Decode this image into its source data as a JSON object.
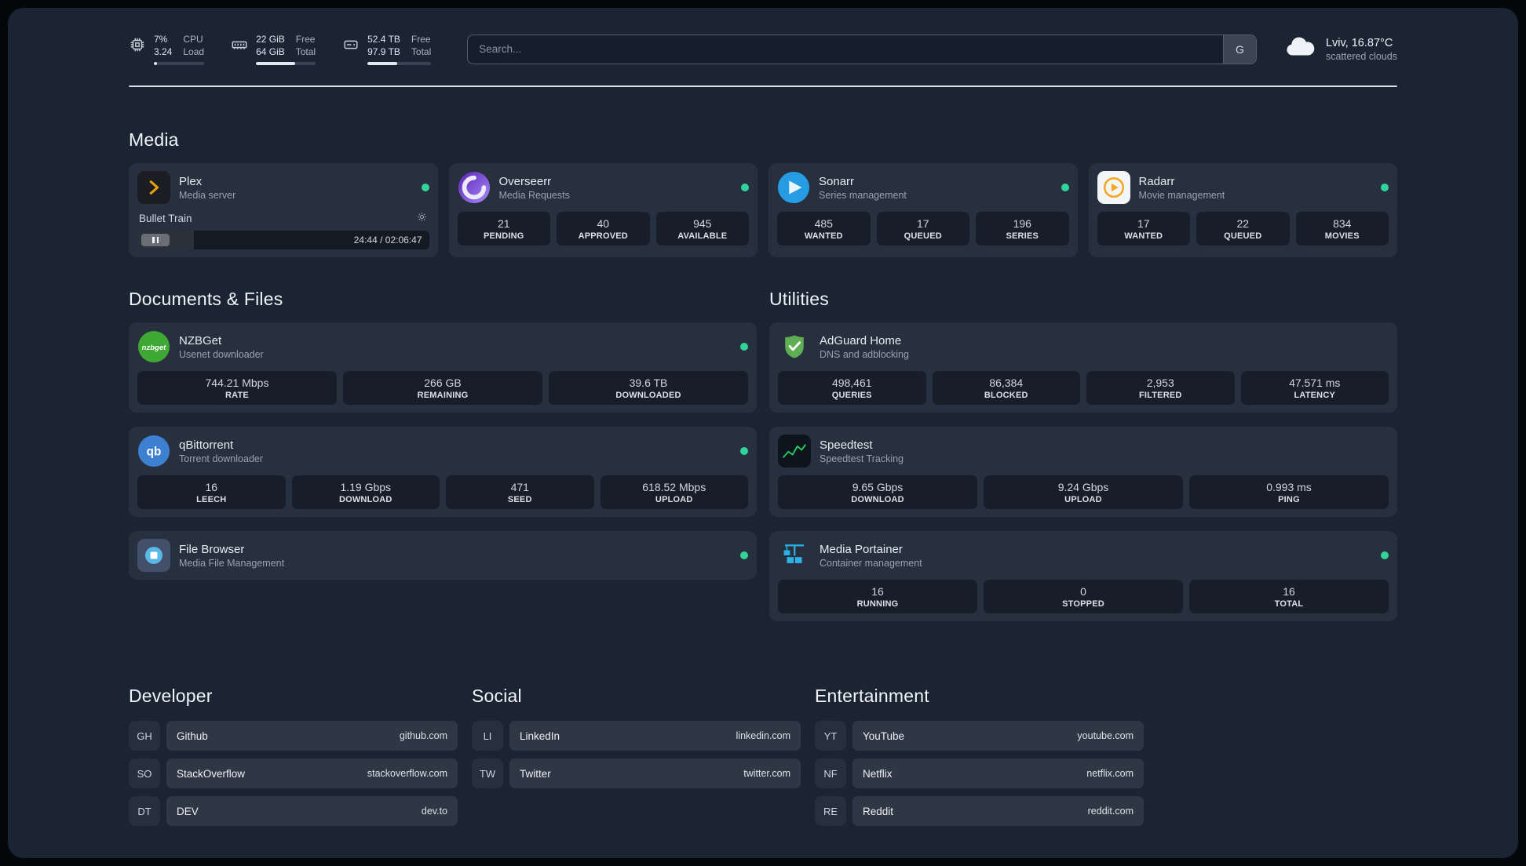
{
  "statusbar": {
    "cpu": {
      "value_top": "7%",
      "value_bottom": "3.24",
      "label_top": "CPU",
      "label_bottom": "Load"
    },
    "ram": {
      "value_top": "22 GiB",
      "value_bottom": "64 GiB",
      "label_top": "Free",
      "label_bottom": "Total"
    },
    "disk": {
      "value_top": "52.4 TB",
      "value_bottom": "97.9 TB",
      "label_top": "Free",
      "label_bottom": "Total"
    },
    "search": {
      "placeholder": "Search...",
      "button_label": "G"
    },
    "weather": {
      "location": "Lviv, 16.87°C",
      "condition": "scattered clouds"
    }
  },
  "section_titles": {
    "media": "Media",
    "documents": "Documents & Files",
    "utilities": "Utilities",
    "developer": "Developer",
    "social": "Social",
    "entertainment": "Entertainment"
  },
  "services": {
    "plex": {
      "name": "Plex",
      "desc": "Media server",
      "now_playing": "Bullet Train",
      "time": "24:44 / 02:06:47"
    },
    "overseerr": {
      "name": "Overseerr",
      "desc": "Media Requests",
      "stats": [
        {
          "value": "21",
          "label": "PENDING"
        },
        {
          "value": "40",
          "label": "APPROVED"
        },
        {
          "value": "945",
          "label": "AVAILABLE"
        }
      ]
    },
    "sonarr": {
      "name": "Sonarr",
      "desc": "Series management",
      "stats": [
        {
          "value": "485",
          "label": "WANTED"
        },
        {
          "value": "17",
          "label": "QUEUED"
        },
        {
          "value": "196",
          "label": "SERIES"
        }
      ]
    },
    "radarr": {
      "name": "Radarr",
      "desc": "Movie management",
      "stats": [
        {
          "value": "17",
          "label": "WANTED"
        },
        {
          "value": "22",
          "label": "QUEUED"
        },
        {
          "value": "834",
          "label": "MOVIES"
        }
      ]
    },
    "nzbget": {
      "name": "NZBGet",
      "desc": "Usenet downloader",
      "stats": [
        {
          "value": "744.21 Mbps",
          "label": "RATE"
        },
        {
          "value": "266 GB",
          "label": "REMAINING"
        },
        {
          "value": "39.6 TB",
          "label": "DOWNLOADED"
        }
      ]
    },
    "qbittorrent": {
      "name": "qBittorrent",
      "desc": "Torrent downloader",
      "stats": [
        {
          "value": "16",
          "label": "LEECH"
        },
        {
          "value": "1.19 Gbps",
          "label": "DOWNLOAD"
        },
        {
          "value": "471",
          "label": "SEED"
        },
        {
          "value": "618.52 Mbps",
          "label": "UPLOAD"
        }
      ]
    },
    "filebrowser": {
      "name": "File Browser",
      "desc": "Media File Management"
    },
    "adguard": {
      "name": "AdGuard Home",
      "desc": "DNS and adblocking",
      "stats": [
        {
          "value": "498,461",
          "label": "QUERIES"
        },
        {
          "value": "86,384",
          "label": "BLOCKED"
        },
        {
          "value": "2,953",
          "label": "FILTERED"
        },
        {
          "value": "47.571 ms",
          "label": "LATENCY"
        }
      ]
    },
    "speedtest": {
      "name": "Speedtest",
      "desc": "Speedtest Tracking",
      "stats": [
        {
          "value": "9.65 Gbps",
          "label": "DOWNLOAD"
        },
        {
          "value": "9.24 Gbps",
          "label": "UPLOAD"
        },
        {
          "value": "0.993 ms",
          "label": "PING"
        }
      ]
    },
    "portainer": {
      "name": "Media Portainer",
      "desc": "Container management",
      "stats": [
        {
          "value": "16",
          "label": "RUNNING"
        },
        {
          "value": "0",
          "label": "STOPPED"
        },
        {
          "value": "16",
          "label": "TOTAL"
        }
      ]
    }
  },
  "bookmarks": {
    "developer": [
      {
        "abbr": "GH",
        "name": "Github",
        "url": "github.com"
      },
      {
        "abbr": "SO",
        "name": "StackOverflow",
        "url": "stackoverflow.com"
      },
      {
        "abbr": "DT",
        "name": "DEV",
        "url": "dev.to"
      }
    ],
    "social": [
      {
        "abbr": "LI",
        "name": "LinkedIn",
        "url": "linkedin.com"
      },
      {
        "abbr": "TW",
        "name": "Twitter",
        "url": "twitter.com"
      }
    ],
    "entertainment": [
      {
        "abbr": "YT",
        "name": "YouTube",
        "url": "youtube.com"
      },
      {
        "abbr": "NF",
        "name": "Netflix",
        "url": "netflix.com"
      },
      {
        "abbr": "RE",
        "name": "Reddit",
        "url": "reddit.com"
      }
    ]
  },
  "colors": {
    "accent_green": "#34d399",
    "plex_amber": "#e5a00d",
    "background": "#1b2433"
  }
}
